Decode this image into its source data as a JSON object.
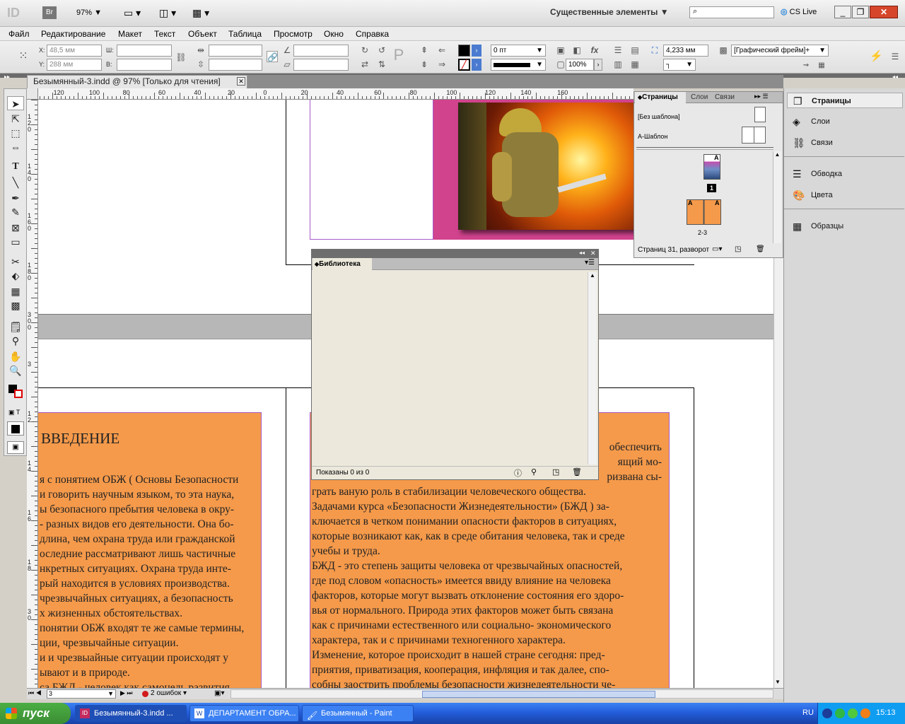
{
  "app": {
    "logo": "ID",
    "bridge": "Br",
    "zoom": "97%",
    "workspace": "Существенные элементы",
    "cslive": "CS Live"
  },
  "menu": [
    "Файл",
    "Редактирование",
    "Макет",
    "Текст",
    "Объект",
    "Таблица",
    "Просмотр",
    "Окно",
    "Справка"
  ],
  "control": {
    "x_label": "X:",
    "x_value": "48,5 мм",
    "y_label": "Y:",
    "y_value": "288 мм",
    "w_label": "Ш:",
    "h_label": "В:",
    "stroke_weight": "0 пт",
    "ref_size": "4,233 мм",
    "scale": "100%",
    "frame_style": "[Графический фрейм]+"
  },
  "document": {
    "tab_title": "Безымянный-3.indd @ 97% [Только для чтения]",
    "ruler_h": [
      "120",
      "100",
      "80",
      "60",
      "40",
      "20",
      "0",
      "20",
      "40",
      "60",
      "80",
      "100",
      "120",
      "140",
      "160"
    ],
    "ruler_v": [
      "1 2 0",
      "1 4 0",
      "1 6 0",
      "1 8 0",
      "3 0 0",
      "3",
      "1 2",
      "1 4",
      "1 6",
      "1 8",
      "3 0"
    ]
  },
  "page_left": {
    "heading": "ВВЕДЕНИЕ",
    "lines": [
      "я с понятием ОБЖ ( Основы Безопасности",
      "и говорить научным языком, то эта наука,",
      "ы безопасного пребытия человека в окру-",
      "- разных видов его деятельности. Она бо-",
      "длина, чем охрана труда или гражданской",
      "оследние рассматривают лишь частичные",
      "нкретных ситуациях. Охрана труда инте-",
      "рый находится в условиях производства.",
      "чрезвычайных ситуациях, а безопасность",
      "х жизненных обстоятельствах.",
      "понятии ОБЖ входят те же самые термины,",
      "ции, чрезвычайные ситуации.",
      "и и чрезвыайные ситуации происходят у",
      "ывают и в природе.",
      "са БЖД - человек как самоцель развития"
    ]
  },
  "page_right": {
    "lines": [
      "обеспечить",
      "ящий мо-",
      "ризвана сы-",
      "грать ваную роль в стабилизации человеческого общества.",
      "   Задачами курса «Безопасности Жизнедеятельности» (БЖД ) за-",
      "ключается в четком понимании опасности факторов в ситуациях,",
      "которые возникают как, как в среде обитания человека, так и среде",
      "учебы и труда.",
      "   БЖД - это степень защиты человека от чрезвычайных опасностей,",
      "где под словом «опасность» имеется ввиду влияние на человека",
      "факторов, которые могут вызвать отклонение состояния его здоро-",
      "вья от нормального. Природа этих факторов может быть связана",
      "как с причинами естественного или социально- экономического",
      "характера, так и с причинами техногенного характера.",
      "   Изменение, которое происходит в нашей стране сегодня: пред-",
      "приятия, приватизация, кооперация, инфляция и так далее, спо-",
      "собны заострить проблемы безопасности жизнедеятельности че-"
    ]
  },
  "pages_panel": {
    "tabs": [
      "Страницы",
      "Слои",
      "Связи"
    ],
    "masters": [
      "[Без шаблона]",
      "A-Шаблон"
    ],
    "page1": "1",
    "spread": "2-3",
    "master_letter": "A",
    "footer": "Страниц 31, разворот"
  },
  "dock": [
    "Страницы",
    "Слои",
    "Связи",
    "Обводка",
    "Цвета",
    "Образцы"
  ],
  "library": {
    "title": "Библиотека",
    "footer": "Показаны 0 из 0"
  },
  "status": {
    "page": "3",
    "errors": "2 ошибок"
  },
  "taskbar": {
    "start": "пуск",
    "tasks": [
      "Безымянный-3.indd ...",
      "ДЕПАРТАМЕНТ ОБРА...",
      "Безымянный - Paint"
    ],
    "lang": "RU",
    "clock": "15:13"
  },
  "colors": {
    "orange": "#f59a4b",
    "magenta": "#d2438e",
    "accent": "#245edb"
  }
}
